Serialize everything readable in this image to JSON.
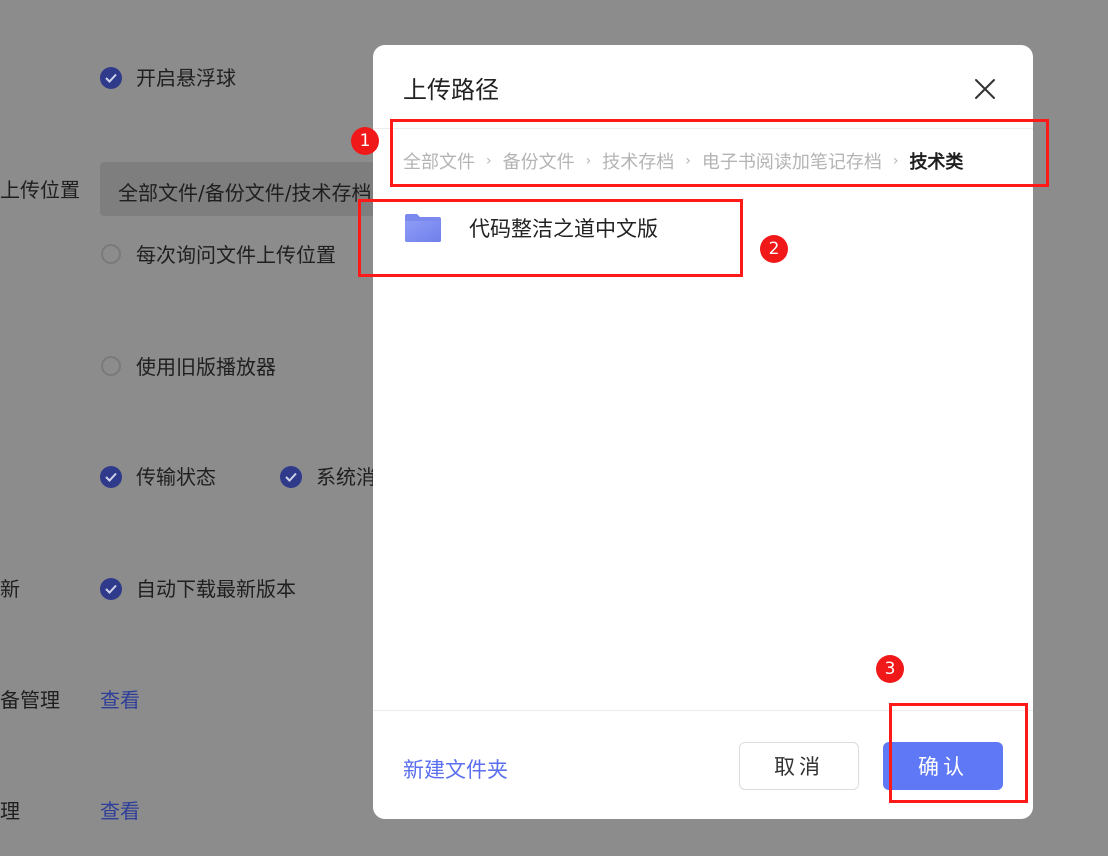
{
  "background": {
    "float_ball": "开启悬浮球",
    "upload_location_label": "上传位置",
    "upload_location_value": "全部文件/备份文件/技术存档",
    "ask_each_time": "每次询问文件上传位置",
    "old_player": "使用旧版播放器",
    "transfer_status": "传输状态",
    "system_msg": "系统消",
    "update_label": "新",
    "auto_download": "自动下载最新版本",
    "device_mgmt_label": "备管理",
    "view_link_1": "查看",
    "mgmt_label": "理",
    "view_link_2": "查看"
  },
  "dialog": {
    "title": "上传路径",
    "breadcrumb": [
      "全部文件",
      "备份文件",
      "技术存档",
      "电子书阅读加笔记存档",
      "技术类"
    ],
    "folder_name": "代码整洁之道中文版",
    "new_folder": "新建文件夹",
    "cancel": "取消",
    "confirm": "确认"
  },
  "annotations": [
    "1",
    "2",
    "3"
  ],
  "colors": {
    "accent": "#5f78f5",
    "link": "#5b6ff0",
    "annotation": "#f01818"
  }
}
